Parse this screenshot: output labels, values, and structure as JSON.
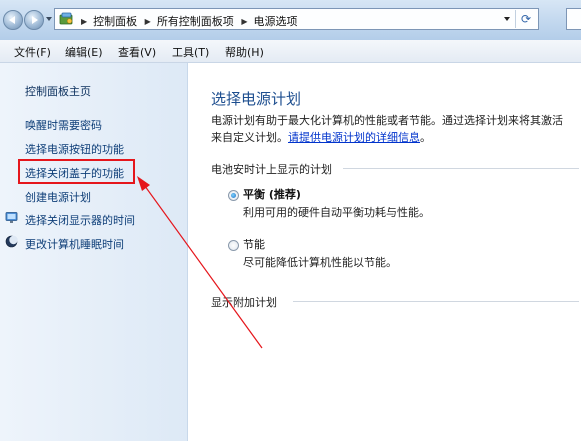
{
  "address": {
    "breadcrumbs": [
      "控制面板",
      "所有控制面板项",
      "电源选项"
    ],
    "icons": {
      "back": "back-arrow-icon",
      "forward": "forward-arrow-icon",
      "location": "control-panel-icon",
      "refresh": "refresh-icon"
    }
  },
  "menu": {
    "file": "文件(F)",
    "edit": "编辑(E)",
    "view": "查看(V)",
    "tools": "工具(T)",
    "help": "帮助(H)"
  },
  "sidebar": {
    "home": "控制面板主页",
    "links": [
      "唤醒时需要密码",
      "选择电源按钮的功能",
      "选择关闭盖子的功能",
      "创建电源计划",
      "选择关闭显示器的时间",
      "更改计算机睡眠时间"
    ],
    "highlighted_index": 2,
    "highlight_color": "#e5161c"
  },
  "main": {
    "title": "选择电源计划",
    "description_line1": "电源计划有助于最大化计算机的性能或者节能。通过选择计划来将其激活",
    "description_line2_prefix": "来自定义计划。",
    "description_link": "请提供电源计划的详细信息",
    "description_line2_suffix": "。",
    "battery_group_label": "电池安时计上显示的计划",
    "plans": [
      {
        "name": "平衡 (推荐)",
        "description": "利用可用的硬件自动平衡功耗与性能。",
        "selected": true
      },
      {
        "name": "节能",
        "description": "尽可能降低计算机性能以节能。",
        "selected": false
      }
    ],
    "additional_group_label": "显示附加计划"
  },
  "annotation": {
    "arrow_color": "#e5161c"
  }
}
